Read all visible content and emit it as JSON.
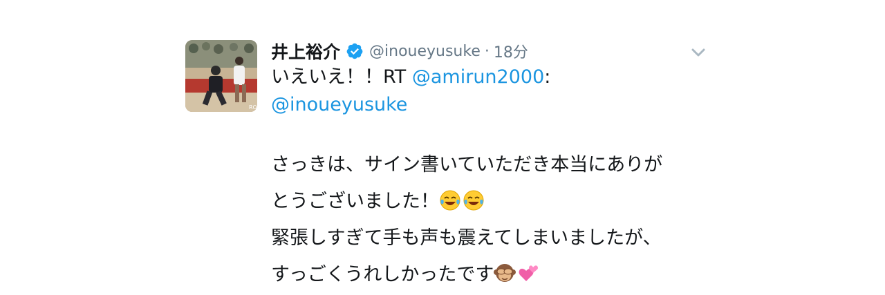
{
  "tweet": {
    "display_name": "井上裕介",
    "handle": "@inoueyusuke",
    "separator": "·",
    "timestamp": "18分",
    "text_prefix": "いえいえ！！RT ",
    "mention_1": "@amirun2000",
    "mention_1_suffix": ":",
    "mention_2": "@inoueyusuke",
    "lines": [
      "さっきは、サイン書いていただき本当にありが",
      "とうございました！",
      "緊張しすぎて手も声も震えてしまいましたが、",
      "すっごくうれしかったです"
    ],
    "emojis": {
      "line2": [
        "face-with-tears-of-joy-emoji",
        "face-with-tears-of-joy-emoji"
      ],
      "line4": [
        "see-no-evil-monkey-emoji",
        "two-hearts-emoji"
      ]
    },
    "icons": {
      "verified": "verified-badge-icon",
      "caret": "chevron-down-icon"
    },
    "colors": {
      "link": "#1b95e0",
      "secondary": "#657786",
      "verified": "#1da1f2"
    }
  }
}
